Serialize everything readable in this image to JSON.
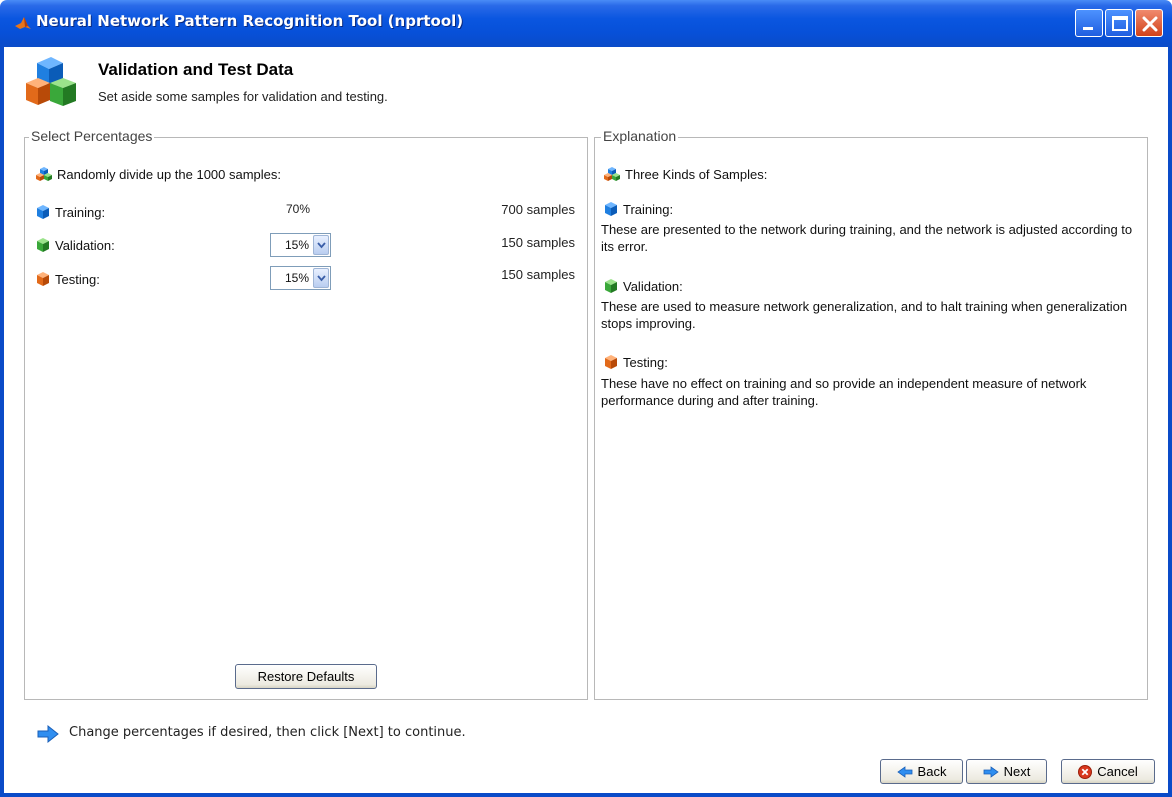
{
  "window": {
    "title": "Neural Network Pattern Recognition Tool (nprtool)"
  },
  "header": {
    "title": "Validation and Test Data",
    "subtitle": "Set aside some samples for validation and testing."
  },
  "select_percentages": {
    "legend": "Select Percentages",
    "intro": "Randomly divide up the 1000 samples:",
    "rows": [
      {
        "label": "Training:",
        "percent": "70%",
        "samples": "700 samples",
        "icon": "blue-cube-icon"
      },
      {
        "label": "Validation:",
        "percent": "15%",
        "samples": "150 samples",
        "icon": "green-cube-icon"
      },
      {
        "label": "Testing:",
        "percent": "15%",
        "samples": "150 samples",
        "icon": "orange-cube-icon"
      }
    ],
    "restore_defaults_label": "Restore Defaults"
  },
  "explanation": {
    "legend": "Explanation",
    "intro": "Three Kinds of Samples:",
    "items": [
      {
        "title": "Training:",
        "text": "These are presented to the network during training, and the network is adjusted according to its error."
      },
      {
        "title": "Validation:",
        "text": "These are used to measure network generalization, and to halt training when generalization stops improving."
      },
      {
        "title": "Testing:",
        "text": "These have no effect on training and so provide an independent measure of network performance during and after training."
      }
    ]
  },
  "footer": {
    "hint": "Change percentages if desired, then click [Next] to continue.",
    "back_label": "Back",
    "next_label": "Next",
    "cancel_label": "Cancel"
  },
  "colors": {
    "titlebar": "#0a56e0",
    "cube_blue": "#1f7fe0",
    "cube_green": "#3aa83a",
    "cube_orange": "#e26a1a"
  }
}
